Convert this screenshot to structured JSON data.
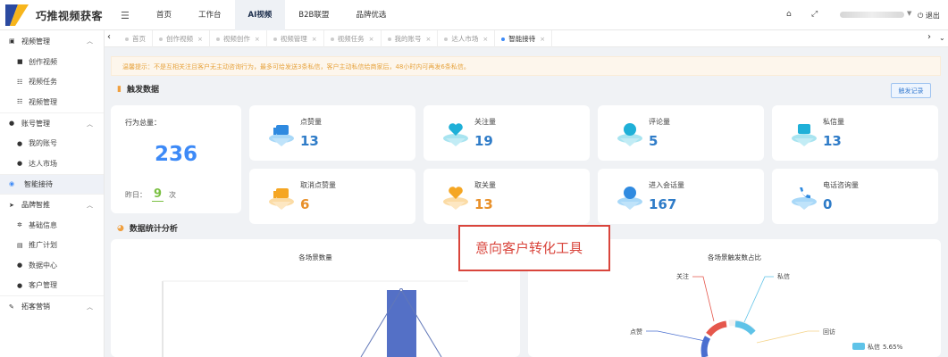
{
  "app": {
    "title": "巧推视频获客",
    "logout": "退出"
  },
  "colors": {
    "accent": "#3d8af7",
    "warning_bg": "#fdf6ec",
    "warning_text": "#e6a23c",
    "callout": "#d9453c",
    "orange": "#e8902a"
  },
  "topnav": [
    {
      "label": "首页"
    },
    {
      "label": "工作台"
    },
    {
      "label": "AI视频",
      "active": true
    },
    {
      "label": "B2B联盟"
    },
    {
      "label": "品牌优选"
    }
  ],
  "sidebar": {
    "groups": [
      {
        "label": "视频管理",
        "icon": "film-icon",
        "items": [
          {
            "label": "创作视频",
            "icon": "camera-icon"
          },
          {
            "label": "视频任务",
            "icon": "list-icon"
          },
          {
            "label": "视频管理",
            "icon": "list-icon"
          }
        ]
      },
      {
        "label": "账号管理",
        "icon": "users-icon",
        "items": [
          {
            "label": "我的账号",
            "icon": "user-icon"
          },
          {
            "label": "达人市场",
            "icon": "user-icon"
          }
        ]
      },
      {
        "label": "智能接待",
        "icon": "eye-icon",
        "items": []
      },
      {
        "label": "品牌智推",
        "icon": "rocket-icon",
        "items": [
          {
            "label": "基础信息",
            "icon": "gear-icon"
          },
          {
            "label": "推广计划",
            "icon": "calendar-icon"
          },
          {
            "label": "数据中心",
            "icon": "people-icon"
          },
          {
            "label": "客户管理",
            "icon": "users-icon"
          }
        ]
      },
      {
        "label": "拓客营销",
        "icon": "pin-icon",
        "items": []
      }
    ]
  },
  "tabs": [
    {
      "label": "首页"
    },
    {
      "label": "创作视频"
    },
    {
      "label": "视频创作"
    },
    {
      "label": "视频管理"
    },
    {
      "label": "视频任务"
    },
    {
      "label": "我的账号"
    },
    {
      "label": "达人市场"
    },
    {
      "label": "智能接待",
      "active": true
    }
  ],
  "notice": "温馨提示：不是互相关注且客户无主动咨询行为，最多可给发送3条私信，客户主动私信给商家后，48小时内可再发6条私信。",
  "section1": {
    "title": "触发数据",
    "button": "触发记录"
  },
  "total": {
    "label": "行为总量：",
    "value": "236",
    "yesterday_prefix": "昨日：",
    "yesterday_value": "9",
    "yesterday_suffix": "次"
  },
  "stats": [
    {
      "label": "点赞量",
      "value": "13",
      "icon": "thumb-up-icon",
      "color": "blue"
    },
    {
      "label": "关注量",
      "value": "19",
      "icon": "heart-icon",
      "color": "blue"
    },
    {
      "label": "评论量",
      "value": "5",
      "icon": "comment-icon",
      "color": "blue"
    },
    {
      "label": "私信量",
      "value": "13",
      "icon": "message-icon",
      "color": "blue"
    },
    {
      "label": "取消点赞量",
      "value": "6",
      "icon": "thumb-up-icon",
      "color": "orange"
    },
    {
      "label": "取关量",
      "value": "13",
      "icon": "heart-icon",
      "color": "orange"
    },
    {
      "label": "进入会话量",
      "value": "167",
      "icon": "chat-icon",
      "color": "blue"
    },
    {
      "label": "电话咨询量",
      "value": "0",
      "icon": "phone-icon",
      "color": "blue"
    }
  ],
  "section2": {
    "title": "数据统计分析"
  },
  "chart_data": [
    {
      "type": "bar",
      "title": "各场景数量",
      "categories": [],
      "values": []
    },
    {
      "type": "pie",
      "title": "各场景触发数占比",
      "labels": [
        "关注",
        "私信",
        "点赞",
        "回访"
      ],
      "legend": [
        {
          "name": "私信",
          "value": "5.65%"
        }
      ]
    }
  ],
  "callout": "意向客户转化工具"
}
